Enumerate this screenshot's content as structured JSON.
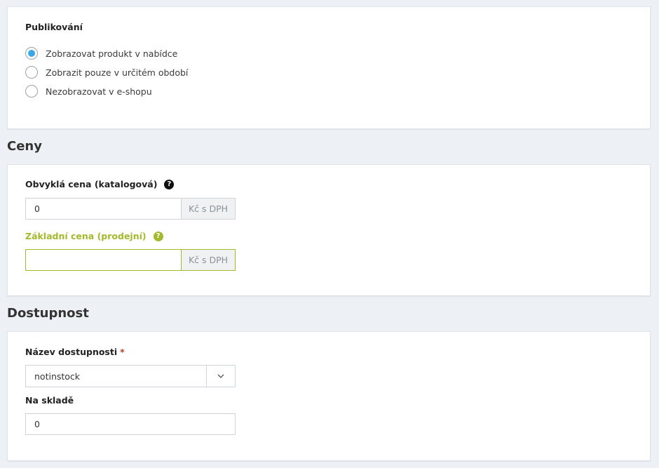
{
  "publishing": {
    "title": "Publikování",
    "options": [
      {
        "label": "Zobrazovat produkt v nabídce",
        "checked": true
      },
      {
        "label": "Zobrazit pouze v určitém období",
        "checked": false
      },
      {
        "label": "Nezobrazovat v e-shopu",
        "checked": false
      }
    ]
  },
  "prices": {
    "section_title": "Ceny",
    "regular_price": {
      "label": "Obvyklá cena (katalogová)",
      "value": "0",
      "addon": "Kč s DPH",
      "help_icon": "question-circle-icon"
    },
    "base_price": {
      "label": "Základní cena (prodejní)",
      "value": "",
      "addon": "Kč s DPH",
      "help_icon": "question-circle-icon",
      "accent_color": "#a3ba2b"
    }
  },
  "availability": {
    "section_title": "Dostupnost",
    "name_label": "Název dostupnosti",
    "required_mark": "*",
    "selected": "notinstock",
    "stock_label": "Na skladě",
    "stock_value": "0"
  },
  "colors": {
    "radio_checked": "#3aa8e6",
    "accent": "#a3ba2b",
    "background": "#edf0f5"
  }
}
